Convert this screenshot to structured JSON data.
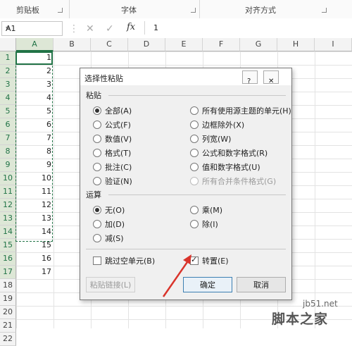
{
  "ribbon": {
    "groups": [
      {
        "label": "剪贴板"
      },
      {
        "label": "字体"
      },
      {
        "label": "对齐方式"
      }
    ]
  },
  "formula_bar": {
    "name_box": "A1",
    "fx_label": "fx",
    "value": "1"
  },
  "sheet": {
    "columns": [
      "A",
      "B",
      "C",
      "D",
      "E",
      "F",
      "G",
      "H",
      "I"
    ],
    "rows": [
      "1",
      "2",
      "3",
      "4",
      "5",
      "6",
      "7",
      "8",
      "9",
      "10",
      "11",
      "12",
      "13",
      "14",
      "15",
      "16",
      "17",
      "18",
      "19",
      "20",
      "21",
      "22"
    ],
    "col_a_values": [
      "1",
      "2",
      "3",
      "4",
      "5",
      "6",
      "7",
      "8",
      "9",
      "10",
      "11",
      "12",
      "13",
      "14",
      "15",
      "16",
      "17"
    ]
  },
  "dialog": {
    "title": "选择性粘贴",
    "help_glyph": "?",
    "close_glyph": "✕",
    "paste_section": "粘贴",
    "paste_left": [
      {
        "label": "全部(A)",
        "checked": true
      },
      {
        "label": "公式(F)",
        "checked": false
      },
      {
        "label": "数值(V)",
        "checked": false
      },
      {
        "label": "格式(T)",
        "checked": false
      },
      {
        "label": "批注(C)",
        "checked": false
      },
      {
        "label": "验证(N)",
        "checked": false
      }
    ],
    "paste_right": [
      {
        "label": "所有使用源主题的单元(H)",
        "disabled": false
      },
      {
        "label": "边框除外(X)",
        "disabled": false
      },
      {
        "label": "列宽(W)",
        "disabled": false
      },
      {
        "label": "公式和数字格式(R)",
        "disabled": false
      },
      {
        "label": "值和数字格式(U)",
        "disabled": false
      },
      {
        "label": "所有合并条件格式(G)",
        "disabled": true
      }
    ],
    "operation_section": "运算",
    "op_left": [
      {
        "label": "无(O)",
        "checked": true
      },
      {
        "label": "加(D)",
        "checked": false
      },
      {
        "label": "减(S)",
        "checked": false
      }
    ],
    "op_right": [
      {
        "label": "乘(M)"
      },
      {
        "label": "除(I)"
      }
    ],
    "skip_blanks": {
      "label": "跳过空单元(B)",
      "checked": false
    },
    "transpose": {
      "label": "转置(E)",
      "checked": true
    },
    "paste_link": "粘贴链接(L)",
    "ok": "确定",
    "cancel": "取消"
  },
  "watermark": {
    "url": "jb51.net",
    "name": "脚本之家"
  },
  "colors": {
    "accent_green": "#217346",
    "arrow_red": "#d9342b"
  }
}
